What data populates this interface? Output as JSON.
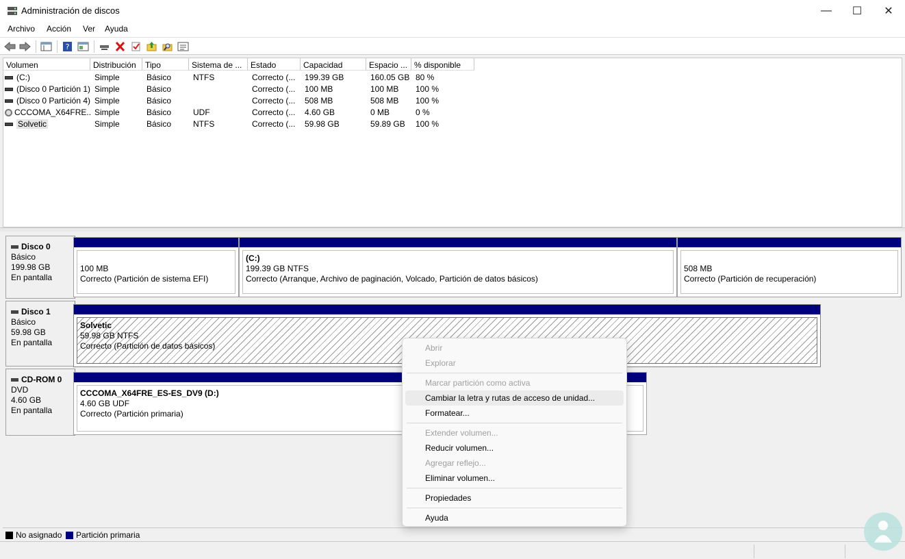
{
  "window": {
    "title": "Administración de discos",
    "minimize_glyph": "—",
    "maximize_glyph": "☐",
    "close_glyph": "✕"
  },
  "menu": [
    "Archivo",
    "Acción",
    "Ver",
    "Ayuda"
  ],
  "toolbar": {
    "icons": [
      "back-arrow-icon",
      "forward-arrow-icon",
      "console-tree-icon",
      "help-icon",
      "properties-icon",
      "connect-icon",
      "delete-icon",
      "check-icon",
      "folder-up-icon",
      "search-folder-icon",
      "settings-icon"
    ]
  },
  "volume_table": {
    "columns": [
      "Volumen",
      "Distribución",
      "Tipo",
      "Sistema de ...",
      "Estado",
      "Capacidad",
      "Espacio ...",
      "% disponible"
    ],
    "rows": [
      [
        "(C:)",
        "Simple",
        "Básico",
        "NTFS",
        "Correcto (...",
        "199.39 GB",
        "160.05 GB",
        "80 %"
      ],
      [
        "(Disco 0 Partición 1)",
        "Simple",
        "Básico",
        "",
        "Correcto (...",
        "100 MB",
        "100 MB",
        "100 %"
      ],
      [
        "(Disco 0 Partición 4)",
        "Simple",
        "Básico",
        "",
        "Correcto (...",
        "508 MB",
        "508 MB",
        "100 %"
      ],
      [
        "CCCOMA_X64FRE...",
        "Simple",
        "Básico",
        "UDF",
        "Correcto (...",
        "4.60 GB",
        "0 MB",
        "0 %"
      ],
      [
        "Solvetic",
        "Simple",
        "Básico",
        "NTFS",
        "Correcto (...",
        "59.98 GB",
        "59.89 GB",
        "100 %"
      ]
    ]
  },
  "disks": [
    {
      "name": "Disco 0",
      "type": "Básico",
      "size": "199.98 GB",
      "status": "En pantalla",
      "partitions": [
        {
          "title": "",
          "size": "100 MB",
          "status": "Correcto (Partición de sistema EFI)"
        },
        {
          "title": "(C:)",
          "size": "199.39 GB NTFS",
          "status": "Correcto (Arranque, Archivo de paginación, Volcado, Partición de datos básicos)"
        },
        {
          "title": "",
          "size": "508 MB",
          "status": "Correcto (Partición de recuperación)"
        }
      ]
    },
    {
      "name": "Disco 1",
      "type": "Básico",
      "size": "59.98 GB",
      "status": "En pantalla",
      "partitions": [
        {
          "title": "Solvetic",
          "size": "59.98 GB NTFS",
          "status": "Correcto (Partición de datos básicos)"
        }
      ]
    },
    {
      "name": "CD-ROM 0",
      "type": "DVD",
      "size": "4.60 GB",
      "status": "En pantalla",
      "partitions": [
        {
          "title": "CCCOMA_X64FRE_ES-ES_DV9  (D:)",
          "size": "4.60 GB UDF",
          "status": "Correcto (Partición primaria)"
        }
      ]
    }
  ],
  "legend": {
    "unallocated": "No asignado",
    "primary": "Partición primaria",
    "unallocated_color": "#000000",
    "primary_color": "#00007f"
  },
  "context_menu": {
    "items": [
      {
        "label": "Abrir",
        "enabled": false
      },
      {
        "label": "Explorar",
        "enabled": false
      },
      {
        "label": "Marcar partición como activa",
        "enabled": false
      },
      {
        "label": "Cambiar la letra y rutas de acceso de unidad...",
        "enabled": true,
        "highlighted": true
      },
      {
        "label": "Formatear...",
        "enabled": true
      },
      {
        "label": "Extender volumen...",
        "enabled": false
      },
      {
        "label": "Reducir volumen...",
        "enabled": true
      },
      {
        "label": "Agregar reflejo...",
        "enabled": false
      },
      {
        "label": "Eliminar volumen...",
        "enabled": true
      },
      {
        "label": "Propiedades",
        "enabled": true
      },
      {
        "label": "Ayuda",
        "enabled": true
      }
    ]
  }
}
